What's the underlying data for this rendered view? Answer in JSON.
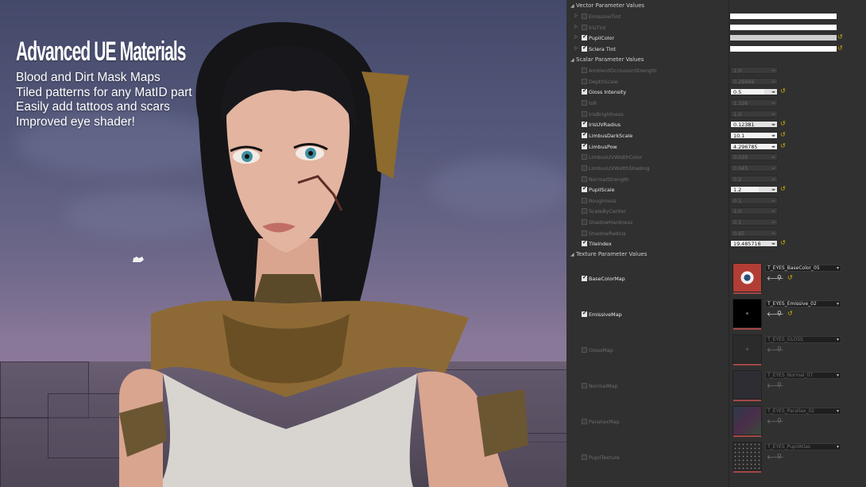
{
  "overlay": {
    "title": "Advanced UE Materials",
    "bullets": [
      "Blood and Dirt Mask Maps",
      "Tiled patterns for any MatID part",
      "Easily add tattoos and scars",
      "Improved eye shader!"
    ]
  },
  "panel": {
    "vector_section": "Vector Parameter Values",
    "vector_params": [
      {
        "name": "EmissiveTint",
        "enabled": false,
        "color": "#ffffff"
      },
      {
        "name": "IrisTint",
        "enabled": false,
        "color": "#ffffff"
      },
      {
        "name": "PupilColor",
        "enabled": true,
        "color": "#cfcfcf"
      },
      {
        "name": "Sclera Tint",
        "enabled": true,
        "color": "#ffffff"
      }
    ],
    "scalar_section": "Scalar Parameter Values",
    "scalar_params": [
      {
        "name": "AmbientOcclusionStrength",
        "enabled": false,
        "value": "1.0"
      },
      {
        "name": "DepthScale",
        "enabled": false,
        "value": "0.26666"
      },
      {
        "name": "Gloss Intensity",
        "enabled": true,
        "value": "0.5"
      },
      {
        "name": "IoR",
        "enabled": false,
        "value": "1.336"
      },
      {
        "name": "IrisBrightness",
        "enabled": false,
        "value": "1.0"
      },
      {
        "name": "IrisUVRadius",
        "enabled": true,
        "value": "0.12381"
      },
      {
        "name": "LimbusDarkScale",
        "enabled": true,
        "value": "10.1"
      },
      {
        "name": "LimbusPow",
        "enabled": true,
        "value": "4.296785"
      },
      {
        "name": "LimbusUVWidthColor",
        "enabled": false,
        "value": "0.035"
      },
      {
        "name": "LimbusUVWidthShading",
        "enabled": false,
        "value": "0.045"
      },
      {
        "name": "NormalStrength",
        "enabled": false,
        "value": "0.2"
      },
      {
        "name": "PupilScale",
        "enabled": true,
        "value": "1.2"
      },
      {
        "name": "Roughness",
        "enabled": false,
        "value": "0.1"
      },
      {
        "name": "ScaleByCenter",
        "enabled": false,
        "value": "1.0"
      },
      {
        "name": "ShadowHardness",
        "enabled": false,
        "value": "0.1"
      },
      {
        "name": "ShadowRadius",
        "enabled": false,
        "value": "0.65"
      },
      {
        "name": "TileIndex",
        "enabled": true,
        "value": "19.485716"
      }
    ],
    "texture_section": "Texture Parameter Values",
    "texture_params": [
      {
        "name": "BaseColorMap",
        "enabled": true,
        "texture": "T_EYES_BaseColor_05"
      },
      {
        "name": "EmissiveMap",
        "enabled": true,
        "texture": "T_EYES_Emissive_02"
      },
      {
        "name": "GlossMap",
        "enabled": false,
        "texture": "T_EYES_GLOSS"
      },
      {
        "name": "NormalMap",
        "enabled": false,
        "texture": "T_EYES_Normal_07"
      },
      {
        "name": "ParallaxMap",
        "enabled": false,
        "texture": "T_EYES_Parallax_02"
      },
      {
        "name": "PupilTexture",
        "enabled": false,
        "texture": "T_EYES_PupilAtlas"
      }
    ]
  },
  "colors": {
    "accent_reset": "#d9b400",
    "panel_bg": "#303030",
    "sky_top": "#44496a",
    "sky_bottom": "#8f7c94"
  }
}
